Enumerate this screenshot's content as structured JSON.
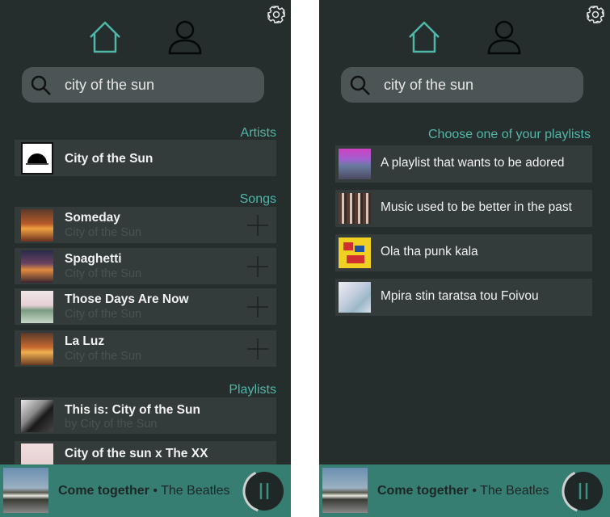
{
  "search": {
    "query": "city of the sun"
  },
  "left": {
    "sections": {
      "artists": "Artists",
      "songs": "Songs",
      "playlists": "Playlists"
    },
    "artist": {
      "name": "City of the Sun"
    },
    "songs": [
      {
        "title": "Someday",
        "artist": "City of the Sun"
      },
      {
        "title": "Spaghetti",
        "artist": "City of the Sun"
      },
      {
        "title": "Those Days Are Now",
        "artist": "City of the Sun"
      },
      {
        "title": "La Luz",
        "artist": "City of the Sun"
      }
    ],
    "playlists": [
      {
        "title": "This is: City of the Sun",
        "owner": "by City of the Sun"
      },
      {
        "title": "City of the sun x The XX",
        "owner": ""
      }
    ]
  },
  "right": {
    "choose_label": "Choose one of your playlists",
    "playlists": [
      {
        "title": "A playlist that wants to be adored"
      },
      {
        "title": "Music used to be better in the past"
      },
      {
        "title": "Ola tha punk kala"
      },
      {
        "title": "Mpira stin taratsa tou Foivou"
      }
    ]
  },
  "player": {
    "song": "Come together",
    "separator": "•",
    "artist": "The Beatles",
    "progress": 0.38
  },
  "colors": {
    "accent": "#4fb8a8",
    "background": "#262d2d",
    "row": "#333b3b",
    "player": "#367d72"
  },
  "icons": [
    "gear-icon",
    "home-icon",
    "user-icon",
    "search-icon",
    "plus-icon",
    "pause-icon"
  ]
}
